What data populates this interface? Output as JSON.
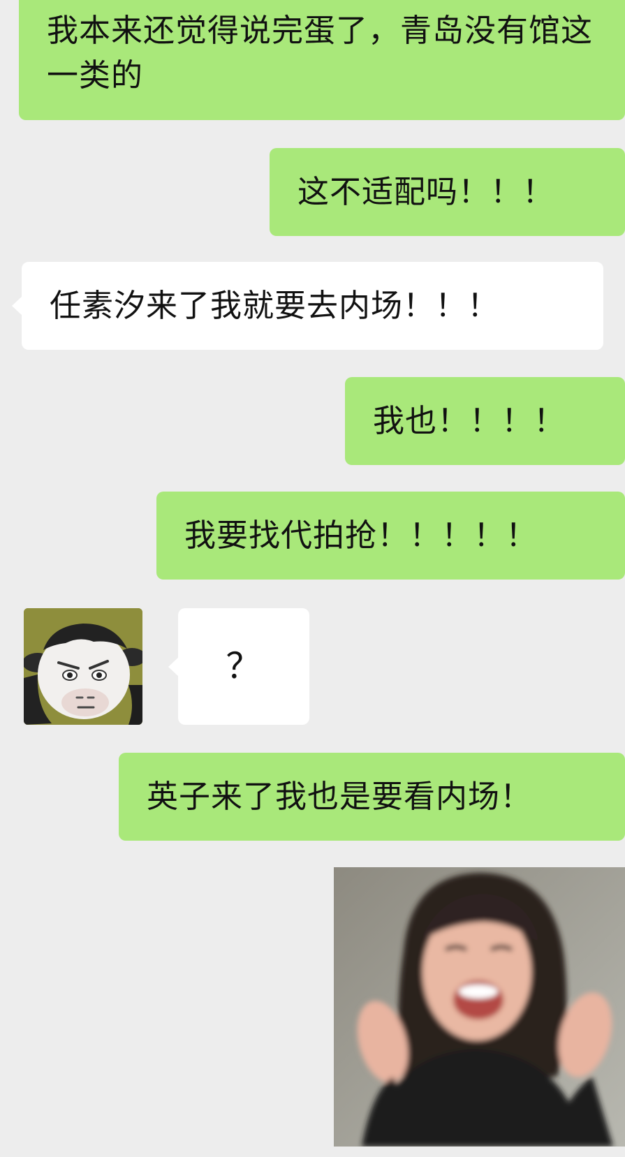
{
  "messages": [
    {
      "side": "sent",
      "text": "我本来还觉得说完蛋了，青岛没有馆这一类的"
    },
    {
      "side": "sent",
      "text": "这不适配吗！！！"
    },
    {
      "side": "received",
      "text": "任素汐来了我就要去内场！！！"
    },
    {
      "side": "sent",
      "text": "我也！！！！"
    },
    {
      "side": "sent",
      "text": "我要找代拍抢！！！！！"
    },
    {
      "side": "received",
      "text": "？"
    },
    {
      "side": "sent",
      "text": "英子来了我也是要看内场！"
    }
  ],
  "avatar": {
    "icon": "cow-face-avatar-icon"
  },
  "sticker": {
    "icon": "laughing-woman-sticker"
  },
  "colors": {
    "background": "#ededed",
    "sent_bubble": "#a9e87a",
    "received_bubble": "#ffffff",
    "text": "#111111"
  }
}
